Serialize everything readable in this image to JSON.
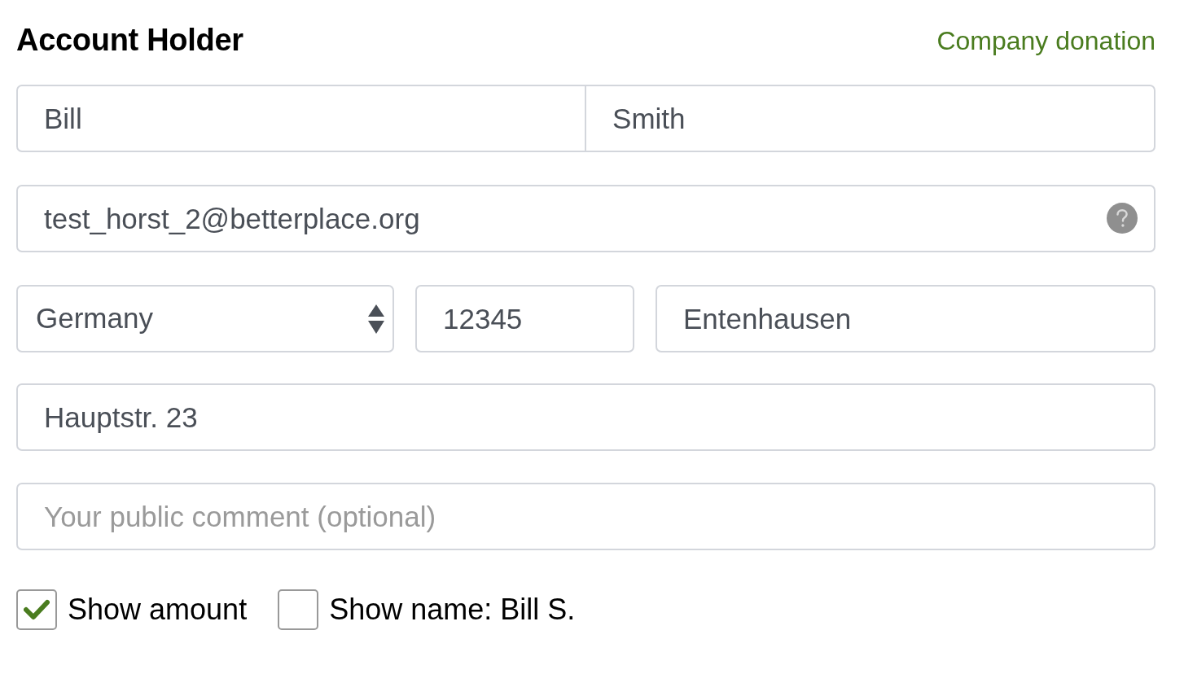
{
  "heading": "Account Holder",
  "company_link": "Company donation",
  "name_fields": [
    {
      "value": "Bill"
    },
    {
      "value": "Smith"
    }
  ],
  "email_field": {
    "value": "test_horst_2@betterplace.org"
  },
  "country_select": {
    "value": "Germany"
  },
  "zip_field": {
    "value": "12345"
  },
  "city_field": {
    "value": "Entenhausen"
  },
  "street_field": {
    "value": "Hauptstr. 23"
  },
  "comment_field": {
    "placeholder": "Your public comment (optional)"
  },
  "options": [
    {
      "label": "Show amount",
      "checked": true
    },
    {
      "label": "Show name: Bill S.",
      "checked": false
    }
  ]
}
